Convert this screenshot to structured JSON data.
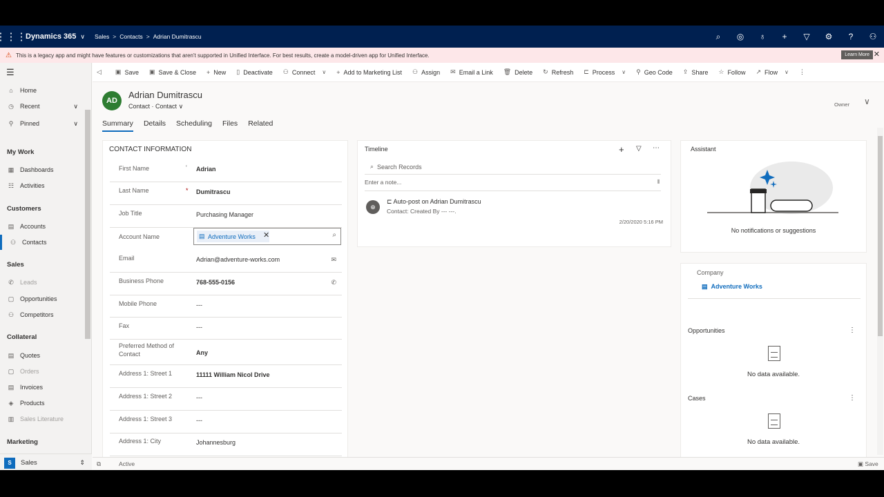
{
  "topbar": {
    "app_name": "Dynamics 365",
    "breadcrumb": [
      "Sales",
      "Contacts",
      "Adrian Dumitrascu"
    ]
  },
  "banner": {
    "message": "This is a legacy app and might have features or customizations that aren't supported in Unified Interface. For best results, create a model-driven app for Unified Interface.",
    "learn_more": "Learn More"
  },
  "sidebar": {
    "top": [
      {
        "label": "Home",
        "icon": "home-icon"
      },
      {
        "label": "Recent",
        "icon": "clock-icon"
      },
      {
        "label": "Pinned",
        "icon": "pin-icon"
      }
    ],
    "sections": [
      {
        "title": "My Work",
        "items": [
          "Dashboards",
          "Activities"
        ]
      },
      {
        "title": "Customers",
        "items": [
          "Accounts",
          "Contacts"
        ]
      },
      {
        "title": "Sales",
        "items": [
          "Leads",
          "Opportunities",
          "Competitors"
        ]
      },
      {
        "title": "Collateral",
        "items": [
          "Quotes",
          "Orders",
          "Invoices",
          "Products",
          "Sales Literature"
        ]
      },
      {
        "title": "Marketing",
        "items": []
      }
    ],
    "area": {
      "badge": "S",
      "label": "Sales"
    }
  },
  "commands": [
    "Save",
    "Save & Close",
    "New",
    "Deactivate",
    "Connect",
    "Add to Marketing List",
    "Assign",
    "Email a Link",
    "Delete",
    "Refresh",
    "Process",
    "Geo Code",
    "Share",
    "Follow",
    "Flow"
  ],
  "record": {
    "initials": "AD",
    "name": "Adrian Dumitrascu",
    "entity": "Contact",
    "form": "Contact",
    "owner_label": "Owner"
  },
  "tabs": [
    "Summary",
    "Details",
    "Scheduling",
    "Files",
    "Related"
  ],
  "contact_info": {
    "title": "CONTACT INFORMATION",
    "fields": [
      {
        "label": "First Name",
        "value": "Adrian"
      },
      {
        "label": "Last Name",
        "value": "Dumitrascu"
      },
      {
        "label": "Job Title",
        "value": "Purchasing Manager"
      },
      {
        "label": "Account Name",
        "value": "Adventure Works"
      },
      {
        "label": "Email",
        "value": "Adrian@adventure-works.com"
      },
      {
        "label": "Business Phone",
        "value": "768-555-0156"
      },
      {
        "label": "Mobile Phone",
        "value": "---"
      },
      {
        "label": "Fax",
        "value": "---"
      },
      {
        "label": "Preferred Method of Contact",
        "value": "Any"
      },
      {
        "label": "Address 1: Street 1",
        "value": "11111 William Nicol Drive"
      },
      {
        "label": "Address 1: Street 2",
        "value": "---"
      },
      {
        "label": "Address 1: Street 3",
        "value": "---"
      },
      {
        "label": "Address 1: City",
        "value": "Johannesburg"
      }
    ]
  },
  "timeline": {
    "title": "Timeline",
    "search_placeholder": "Search Records",
    "note_placeholder": "Enter a note...",
    "item_title": "Auto-post on Adrian Dumitrascu",
    "item_sub": "Contact: Created By --- ---.",
    "item_date": "2/20/2020 5:16 PM"
  },
  "assistant": {
    "title": "Assistant",
    "empty": "No notifications or suggestions"
  },
  "company": {
    "label": "Company",
    "value": "Adventure Works"
  },
  "opportunities": {
    "title": "Opportunities",
    "empty": "No data available."
  },
  "cases": {
    "title": "Cases",
    "empty": "No data available."
  },
  "status": {
    "state": "Active",
    "save": "Save"
  }
}
